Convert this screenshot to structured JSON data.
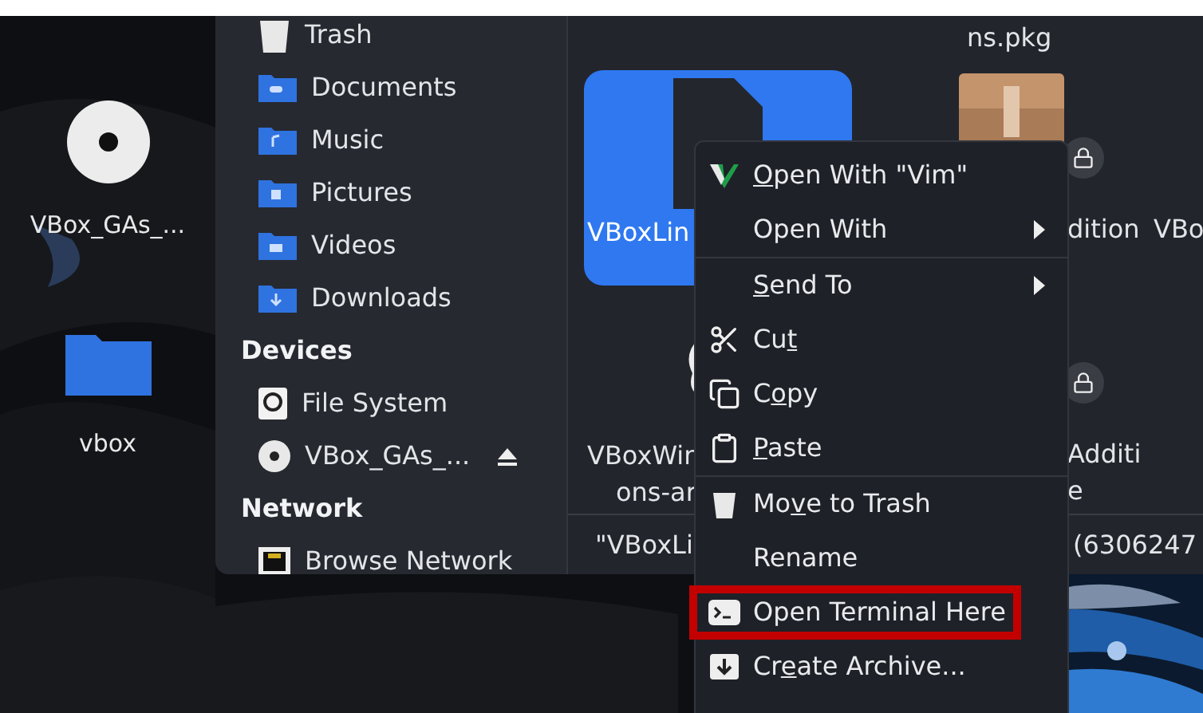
{
  "desktop_icons": [
    {
      "label": "VBox_GAs_..."
    },
    {
      "label": "vbox"
    }
  ],
  "sidebar": [
    {
      "kind": "place",
      "label": "Trash"
    },
    {
      "kind": "place",
      "label": "Documents"
    },
    {
      "kind": "place",
      "label": "Music"
    },
    {
      "kind": "place",
      "label": "Pictures"
    },
    {
      "kind": "place",
      "label": "Videos"
    },
    {
      "kind": "place",
      "label": "Downloads"
    },
    {
      "kind": "heading",
      "label": "Devices"
    },
    {
      "kind": "device",
      "label": "File System",
      "ejectable": false
    },
    {
      "kind": "device",
      "label": "VBox_GAs_...",
      "ejectable": true
    },
    {
      "kind": "heading",
      "label": "Network"
    },
    {
      "kind": "device",
      "label": "Browse Network",
      "ejectable": false
    }
  ],
  "file_rows": [
    {
      "kind": "labels",
      "cells": [
        null,
        {
          "lines": [
            "ns.pkg"
          ]
        },
        null
      ]
    },
    {
      "kind": "icons",
      "cells": [
        {
          "lines": [
            "VBoxLin"
          ],
          "selected": true,
          "locked": false
        },
        {
          "lines": [
            "dition"
          ],
          "selected": false,
          "locked": true
        },
        {
          "lines": [
            "VBo"
          ],
          "selected": false,
          "locked": false
        }
      ]
    },
    {
      "kind": "icons",
      "cells": [
        {
          "lines": [
            "VBoxWin",
            "ons-ar"
          ],
          "selected": false,
          "locked": false
        },
        {
          "lines": [
            "Additi",
            "e"
          ],
          "selected": false,
          "locked": true
        },
        null
      ]
    }
  ],
  "status_bar": {
    "left": "\"VBoxLi",
    "right": "(6306247"
  },
  "context_menu": [
    {
      "kind": "action",
      "segments": [
        {
          "text": "O",
          "underline": true
        },
        {
          "text": "pen With \"Vim\"",
          "underline": false
        }
      ]
    },
    {
      "kind": "submenu",
      "segments": [
        {
          "text": "Open With",
          "underline": false
        }
      ]
    },
    {
      "kind": "separator"
    },
    {
      "kind": "submenu",
      "segments": [
        {
          "text": "S",
          "underline": true
        },
        {
          "text": "end To",
          "underline": false
        }
      ]
    },
    {
      "kind": "action",
      "segments": [
        {
          "text": "Cu",
          "underline": false
        },
        {
          "text": "t",
          "underline": true
        }
      ]
    },
    {
      "kind": "action",
      "segments": [
        {
          "text": "C",
          "underline": false
        },
        {
          "text": "o",
          "underline": true
        },
        {
          "text": "py",
          "underline": false
        }
      ]
    },
    {
      "kind": "action",
      "segments": [
        {
          "text": "P",
          "underline": true
        },
        {
          "text": "aste",
          "underline": false
        }
      ]
    },
    {
      "kind": "separator"
    },
    {
      "kind": "action",
      "segments": [
        {
          "text": "Mo",
          "underline": false
        },
        {
          "text": "v",
          "underline": true
        },
        {
          "text": "e to Trash",
          "underline": false
        }
      ]
    },
    {
      "kind": "action",
      "segments": [
        {
          "text": "Rename",
          "underline": false
        }
      ]
    },
    {
      "kind": "action",
      "segments": [
        {
          "text": "Open Terminal Here",
          "underline": false
        }
      ],
      "highlighted": true
    },
    {
      "kind": "action",
      "segments": [
        {
          "text": "Cr",
          "underline": false
        },
        {
          "text": "e",
          "underline": true
        },
        {
          "text": "ate Archive...",
          "underline": false
        }
      ]
    }
  ]
}
